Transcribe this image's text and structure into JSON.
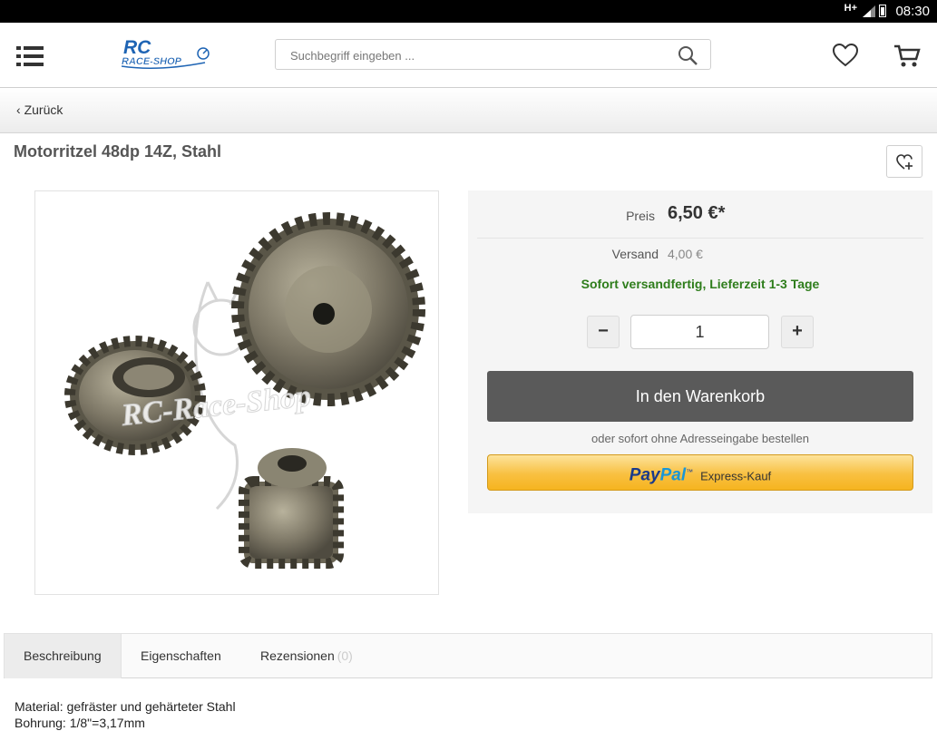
{
  "status_bar": {
    "network": "H+",
    "time": "08:30"
  },
  "header": {
    "logo_line1": "RC",
    "logo_line2": "RACE-SHOP",
    "search_placeholder": "Suchbegriff eingeben ..."
  },
  "nav": {
    "back_label": "Zurück"
  },
  "product": {
    "title": "Motorritzel 48dp 14Z, Stahl",
    "watermark": "RC-Race-Shop",
    "price_label": "Preis",
    "price_value": "6,50 €*",
    "shipping_label": "Versand",
    "shipping_value": "4,00 €",
    "availability": "Sofort versandfertig, Lieferzeit 1-3 Tage",
    "quantity": "1",
    "minus_label": "−",
    "plus_label": "+",
    "cart_button": "In den Warenkorb",
    "or_text": "oder sofort ohne Adresseingabe bestellen",
    "paypal_pay": "Pay",
    "paypal_pal": "Pal",
    "paypal_tm": "™",
    "paypal_express": "Express-Kauf"
  },
  "tabs": [
    {
      "label": "Beschreibung",
      "count": ""
    },
    {
      "label": "Eigenschaften",
      "count": ""
    },
    {
      "label": "Rezensionen",
      "count": "(0)"
    }
  ],
  "description": {
    "line1": "Material: gefräster und gehärteter Stahl",
    "line2": "Bohrung: 1/8\"=3,17mm"
  },
  "colors": {
    "cart_button": "#5a5a5a",
    "availability_green": "#2e7d1b",
    "paypal_yellow": "#f8c041",
    "logo_blue": "#1e64b4"
  },
  "icons": {
    "menu": "menu-icon",
    "search": "search-icon",
    "wishlist": "heart-icon",
    "cart": "cart-icon",
    "note": "heart-plus-icon"
  }
}
